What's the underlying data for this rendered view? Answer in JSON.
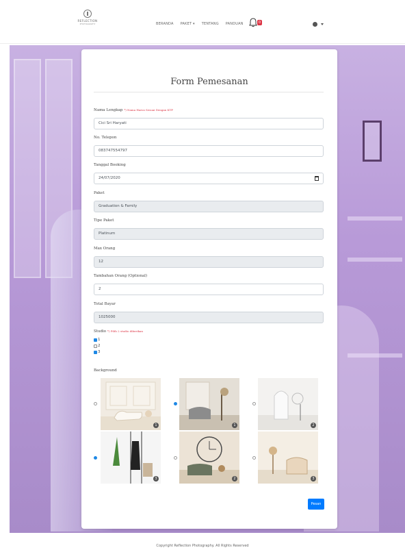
{
  "brand": {
    "name": "REFLECTION",
    "sub": "PHOTOGRAPHY"
  },
  "nav": {
    "items": [
      "BERANDA",
      "PAKET ▾",
      "TENTANG",
      "PANDUAN"
    ],
    "notif_count": "0"
  },
  "form": {
    "title": "Form Pemesanan",
    "nama": {
      "label": "Nama Lengkap",
      "note": "*) Nama Harus Sesuai Dengan KTP",
      "value": "Cici Sri Haryati"
    },
    "telepon": {
      "label": "No. Telepon",
      "value": "083747554797"
    },
    "tanggal": {
      "label": "Tanggal Booking",
      "value": "24/07/2020"
    },
    "paket": {
      "label": "Paket",
      "value": "Graduation & Family"
    },
    "tipe": {
      "label": "Tipe Paket",
      "value": "Platinum"
    },
    "max_orang": {
      "label": "Max Orang",
      "value": "12"
    },
    "tambahan": {
      "label": "Tambahan Orang (Optional)",
      "value": "2"
    },
    "total": {
      "label": "Total Bayar",
      "value": "1025000"
    },
    "studio": {
      "label": "Studio",
      "note": "*) Pilih 2 studio diberikan",
      "options": [
        {
          "label": "1",
          "checked": true
        },
        {
          "label": "2",
          "checked": false
        },
        {
          "label": "3",
          "checked": true
        }
      ]
    },
    "background": {
      "label": "Background",
      "options": [
        {
          "num": "1",
          "selected": false
        },
        {
          "num": "1",
          "selected": true
        },
        {
          "num": "2",
          "selected": false
        },
        {
          "num": "3",
          "selected": true
        },
        {
          "num": "2",
          "selected": false
        },
        {
          "num": "3",
          "selected": false
        }
      ]
    },
    "submit": "Pesan"
  },
  "footer": "Copyright Reflection Photography. All Rights Reserved"
}
